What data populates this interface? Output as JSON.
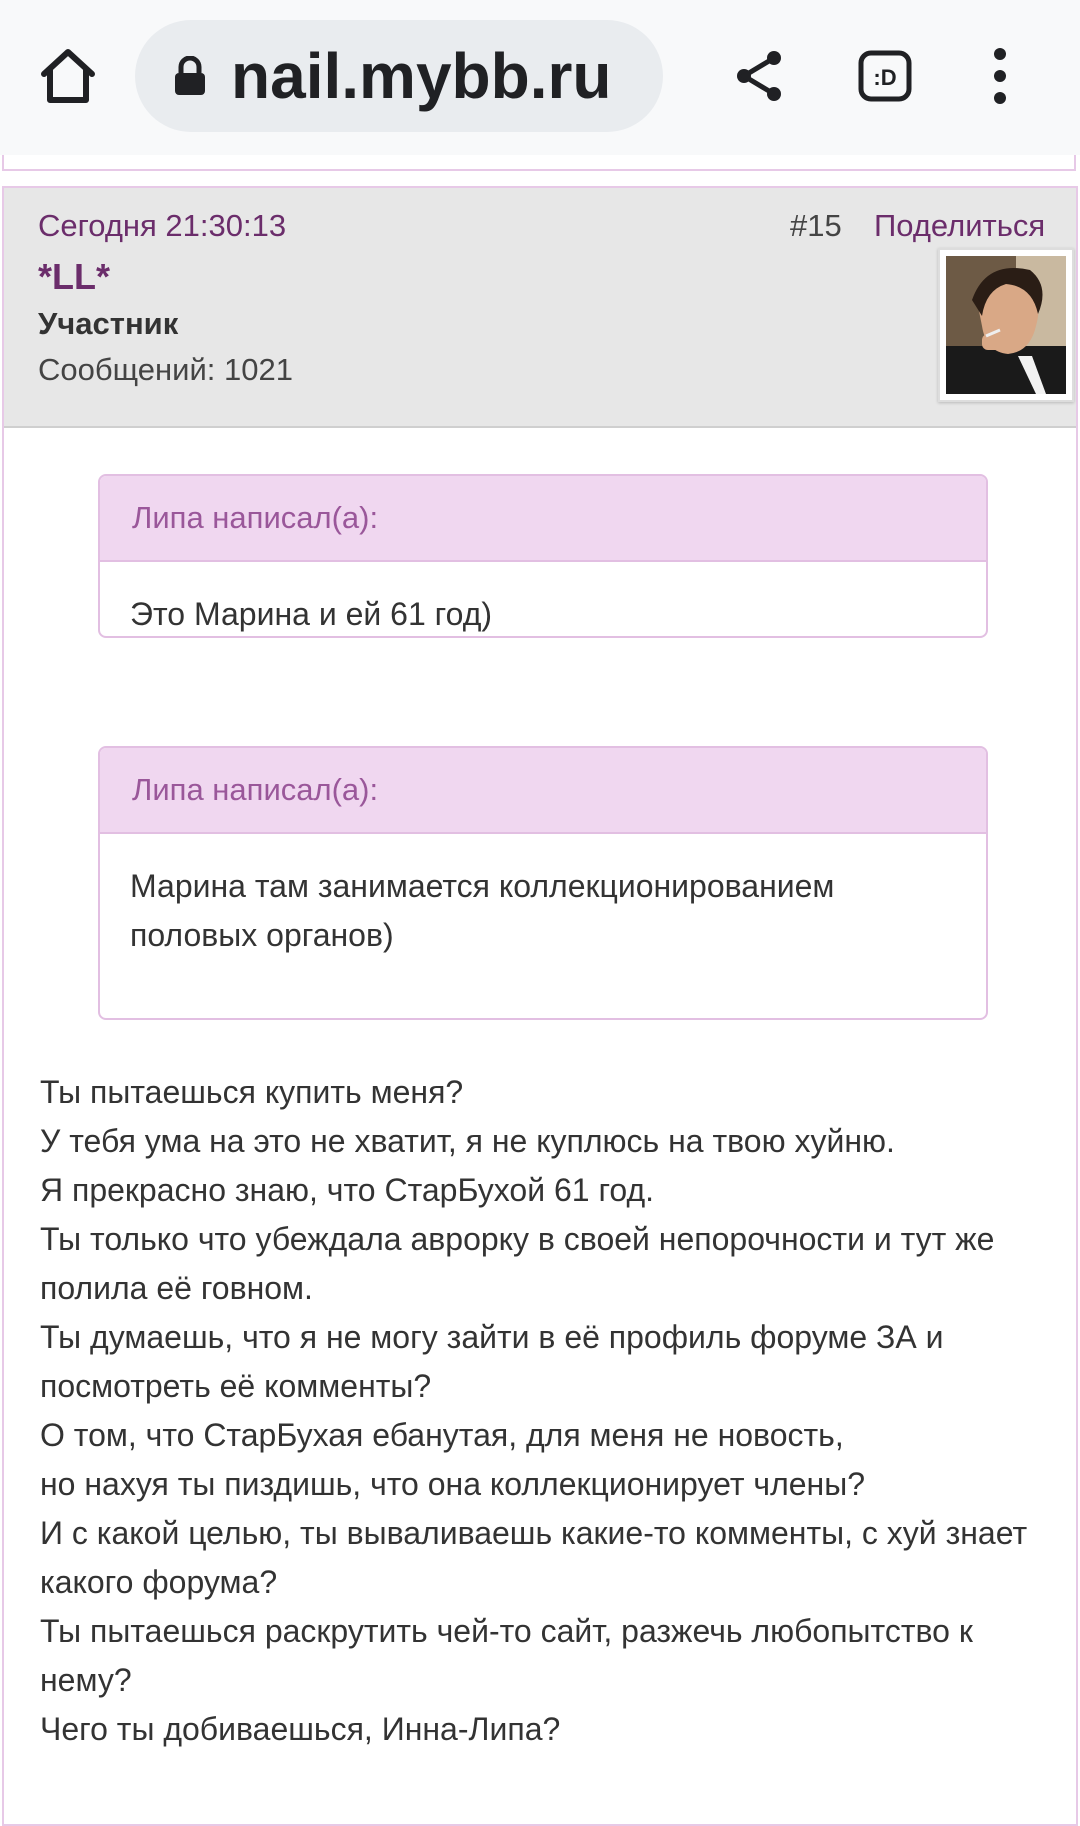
{
  "browser": {
    "url": "nail.mybb.ru",
    "icons": [
      "home-icon",
      "lock-icon",
      "share-icon",
      "dx-extension-icon",
      "more-vert-icon"
    ]
  },
  "post": {
    "time": "Сегодня 21:30:13",
    "number": "#15",
    "share_label": "Поделиться",
    "author": "*LL*",
    "role": "Участник",
    "messages": "Сообщений: 1021",
    "quotes": [
      {
        "header": "Липа написал(а):",
        "text": "Это Марина и ей 61 год)"
      },
      {
        "header": "Липа написал(а):",
        "text": "Марина там занимается коллекционированием половых органов)"
      }
    ],
    "lines": [
      "Ты пытаешься купить меня?",
      "У тебя ума на это не хватит, я не куплюсь на твою хуйню.",
      "Я прекрасно знаю, что СтарБухой 61 год.",
      "Ты только что убеждала аврорку в своей непорочности и тут же полила её говном.",
      "Ты думаешь, что я не могу зайти в её профиль форуме ЗА и посмотреть её комменты?",
      "О том, что СтарБухая ебанутая, для меня не новость,",
      "но нахуя ты пиздишь, что она коллекционирует члены?",
      "И с какой целью, ты вываливаешь какие-то комменты, с хуй знает какого форума?",
      "Ты пытаешься раскрутить чей-то сайт, разжечь любопытство к нему?",
      "Чего ты добиваешься, Инна-Липа?"
    ]
  },
  "colors": {
    "accent": "#6b2d6b",
    "quote_header_bg": "#f0d7f0",
    "post_header_bg": "#e7e7e7",
    "border": "#e7c9e7"
  }
}
